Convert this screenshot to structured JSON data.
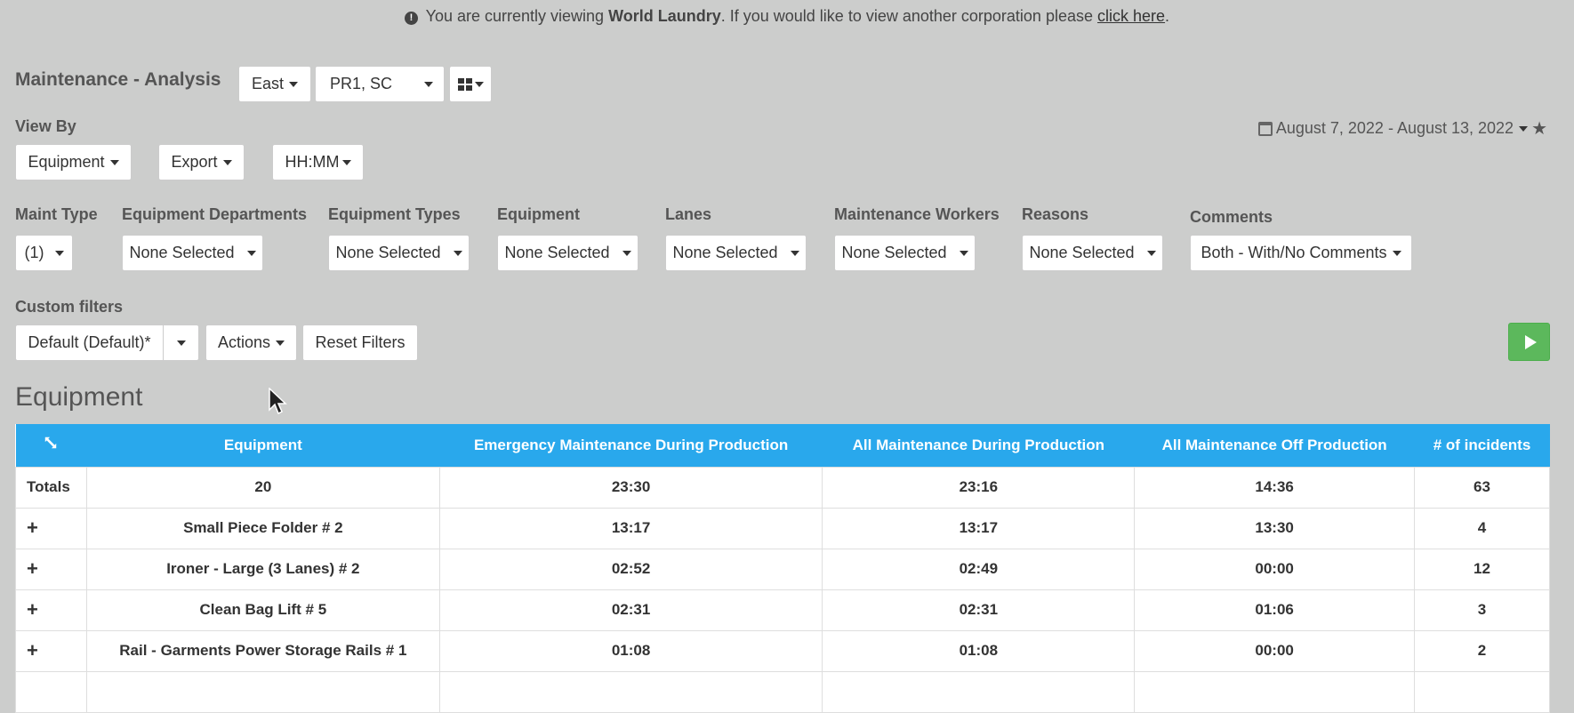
{
  "banner": {
    "prefix": "You are currently viewing",
    "corporation": "World Laundry",
    "suffix": ". If you would like to view another corporation please",
    "link": "click here",
    "end": "."
  },
  "header": {
    "title": "Maintenance - Analysis",
    "region": "East",
    "plants": "PR1, SC"
  },
  "view_by": {
    "label": "View By",
    "equipment": "Equipment",
    "export": "Export",
    "time_format": "HH:MM"
  },
  "date_range": "August 7, 2022 - August 13, 2022",
  "filters": {
    "maint_type": {
      "label": "Maint Type",
      "value": "(1)"
    },
    "equipment_departments": {
      "label": "Equipment Departments",
      "value": "None Selected"
    },
    "equipment_types": {
      "label": "Equipment Types",
      "value": "None Selected"
    },
    "equipment": {
      "label": "Equipment",
      "value": "None Selected"
    },
    "lanes": {
      "label": "Lanes",
      "value": "None Selected"
    },
    "maintenance_workers": {
      "label": "Maintenance Workers",
      "value": "None Selected"
    },
    "reasons": {
      "label": "Reasons",
      "value": "None Selected"
    },
    "comments": {
      "label": "Comments",
      "value": "Both - With/No Comments"
    }
  },
  "custom_filters": {
    "label": "Custom filters",
    "preset": "Default (Default)*",
    "actions": "Actions",
    "reset": "Reset Filters"
  },
  "section_title": "Equipment",
  "table": {
    "headers": [
      "Equipment",
      "Emergency Maintenance During Production",
      "All Maintenance During Production",
      "All Maintenance Off Production",
      "# of incidents"
    ],
    "totals": {
      "label": "Totals",
      "cells": [
        "20",
        "23:30",
        "23:16",
        "14:36",
        "63"
      ]
    },
    "rows": [
      {
        "expand": "+",
        "cells": [
          "Small Piece Folder # 2",
          "13:17",
          "13:17",
          "13:30",
          "4"
        ]
      },
      {
        "expand": "+",
        "cells": [
          "Ironer - Large (3 Lanes) # 2",
          "02:52",
          "02:49",
          "00:00",
          "12"
        ]
      },
      {
        "expand": "+",
        "cells": [
          "Clean Bag Lift # 5",
          "02:31",
          "02:31",
          "01:06",
          "3"
        ]
      },
      {
        "expand": "+",
        "cells": [
          "Rail - Garments Power Storage Rails # 1",
          "01:08",
          "01:08",
          "00:00",
          "2"
        ]
      }
    ]
  },
  "colors": {
    "background": "#cccdcc",
    "table_header": "#29a8ec",
    "run_button": "#5cb85c"
  }
}
